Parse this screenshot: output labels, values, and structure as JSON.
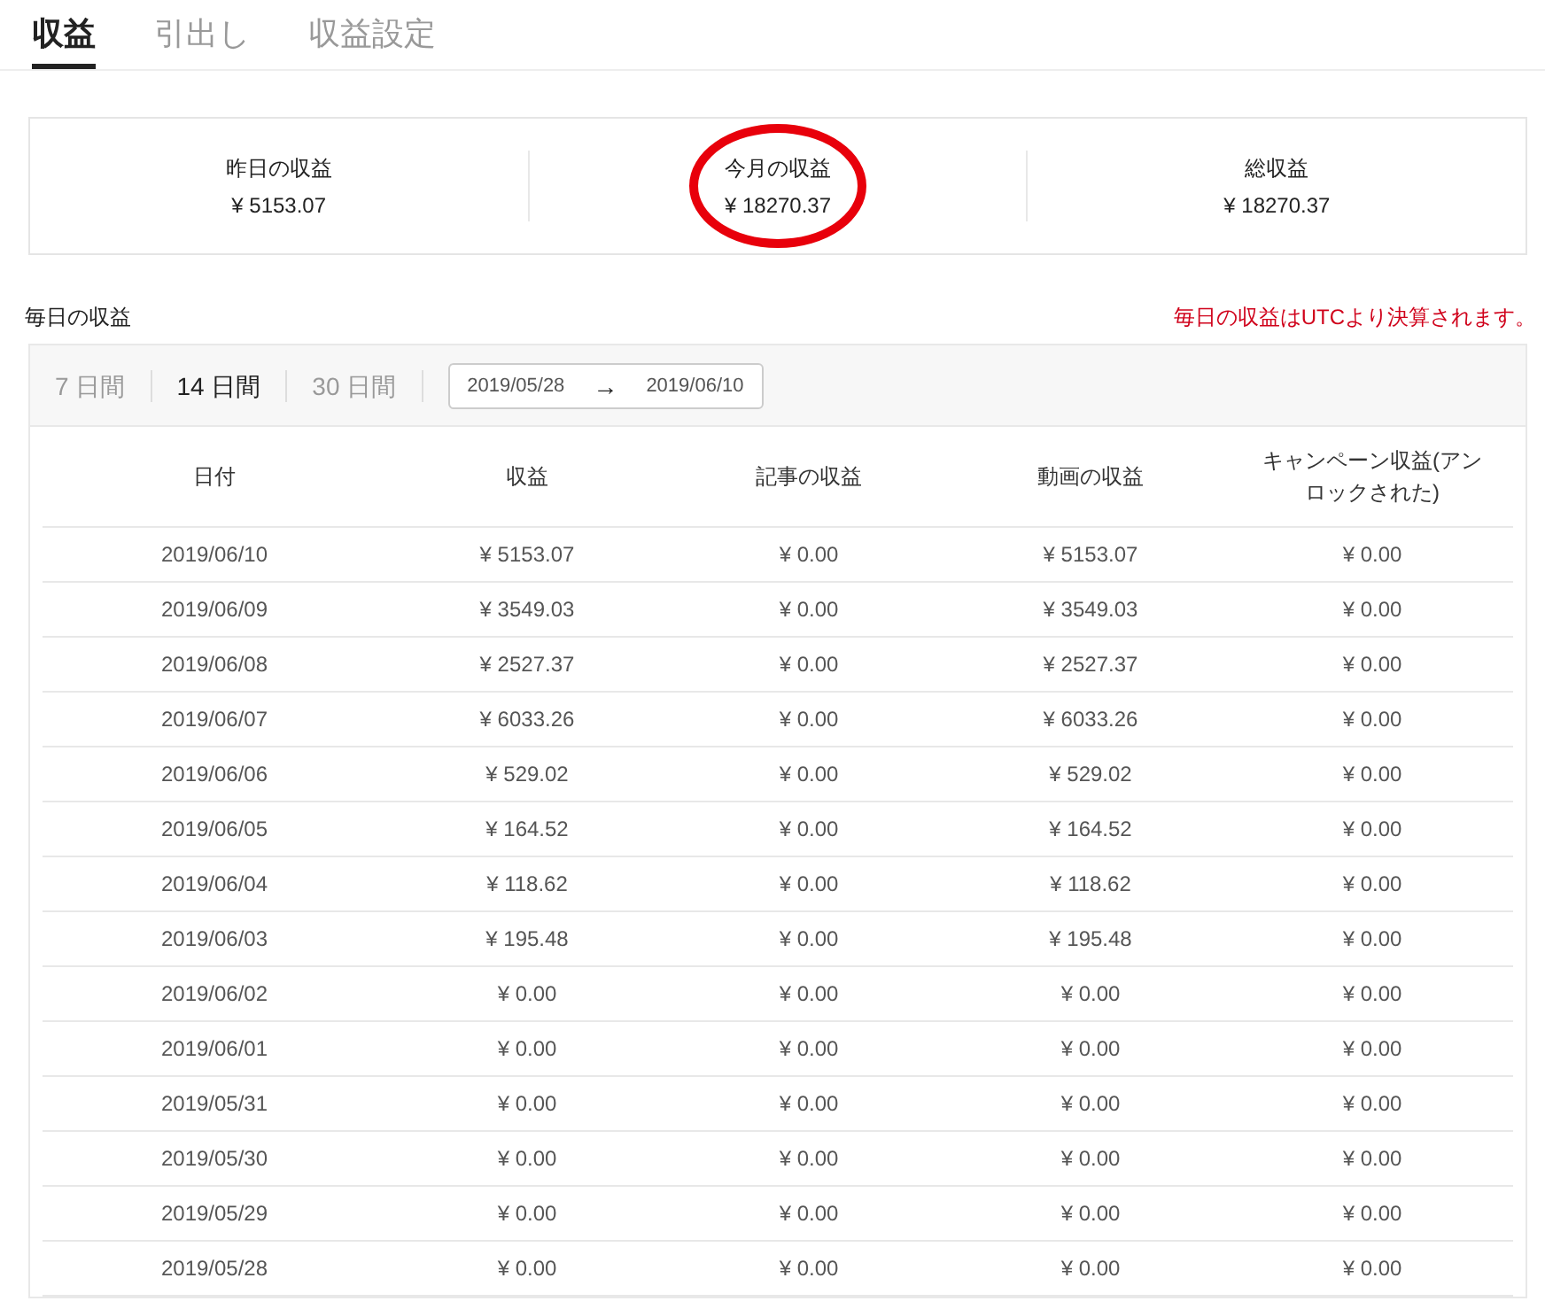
{
  "tabs": [
    {
      "label": "収益",
      "selected": true
    },
    {
      "label": "引出し",
      "selected": false
    },
    {
      "label": "収益設定",
      "selected": false
    }
  ],
  "summary": [
    {
      "label": "昨日の収益",
      "value": "¥ 5153.07",
      "circled": false
    },
    {
      "label": "今月の収益",
      "value": "¥ 18270.37",
      "circled": true
    },
    {
      "label": "総収益",
      "value": "¥ 18270.37",
      "circled": false
    }
  ],
  "daily": {
    "title": "毎日の収益",
    "note": "毎日の収益はUTCより決算されます。",
    "ranges": [
      {
        "label": "7 日間",
        "selected": false
      },
      {
        "label": "14 日間",
        "selected": true
      },
      {
        "label": "30 日間",
        "selected": false
      }
    ],
    "date_range": {
      "start": "2019/05/28",
      "arrow": "→",
      "end": "2019/06/10"
    },
    "table": {
      "columns": [
        "日付",
        "収益",
        "記事の収益",
        "動画の収益",
        "キャンペーン収益(アンロックされた)"
      ],
      "rows": [
        [
          "2019/06/10",
          "¥ 5153.07",
          "¥ 0.00",
          "¥ 5153.07",
          "¥ 0.00"
        ],
        [
          "2019/06/09",
          "¥ 3549.03",
          "¥ 0.00",
          "¥ 3549.03",
          "¥ 0.00"
        ],
        [
          "2019/06/08",
          "¥ 2527.37",
          "¥ 0.00",
          "¥ 2527.37",
          "¥ 0.00"
        ],
        [
          "2019/06/07",
          "¥ 6033.26",
          "¥ 0.00",
          "¥ 6033.26",
          "¥ 0.00"
        ],
        [
          "2019/06/06",
          "¥ 529.02",
          "¥ 0.00",
          "¥ 529.02",
          "¥ 0.00"
        ],
        [
          "2019/06/05",
          "¥ 164.52",
          "¥ 0.00",
          "¥ 164.52",
          "¥ 0.00"
        ],
        [
          "2019/06/04",
          "¥ 118.62",
          "¥ 0.00",
          "¥ 118.62",
          "¥ 0.00"
        ],
        [
          "2019/06/03",
          "¥ 195.48",
          "¥ 0.00",
          "¥ 195.48",
          "¥ 0.00"
        ],
        [
          "2019/06/02",
          "¥ 0.00",
          "¥ 0.00",
          "¥ 0.00",
          "¥ 0.00"
        ],
        [
          "2019/06/01",
          "¥ 0.00",
          "¥ 0.00",
          "¥ 0.00",
          "¥ 0.00"
        ],
        [
          "2019/05/31",
          "¥ 0.00",
          "¥ 0.00",
          "¥ 0.00",
          "¥ 0.00"
        ],
        [
          "2019/05/30",
          "¥ 0.00",
          "¥ 0.00",
          "¥ 0.00",
          "¥ 0.00"
        ],
        [
          "2019/05/29",
          "¥ 0.00",
          "¥ 0.00",
          "¥ 0.00",
          "¥ 0.00"
        ],
        [
          "2019/05/28",
          "¥ 0.00",
          "¥ 0.00",
          "¥ 0.00",
          "¥ 0.00"
        ]
      ]
    }
  }
}
